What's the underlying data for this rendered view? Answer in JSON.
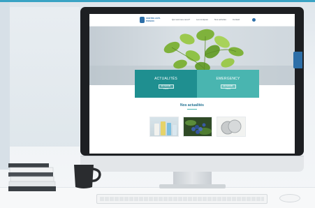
{
  "site": {
    "logo_text": "CENTRE ANTI-POISON",
    "nav": [
      "Qui sommes-nous?",
      "Les toxiques",
      "Nos activités",
      "Contact"
    ],
    "tiles": [
      {
        "title": "ACTUALITÉS",
        "button": "EN SAVOIR PLUS"
      },
      {
        "title": "EMERGENCY",
        "button": "EN SAVOIR PLUS"
      }
    ],
    "section_title": "Nos actualités"
  },
  "colors": {
    "accent_dark": "#1f8f90",
    "accent_light": "#49b5b0",
    "brand_blue": "#2d6fa8"
  }
}
